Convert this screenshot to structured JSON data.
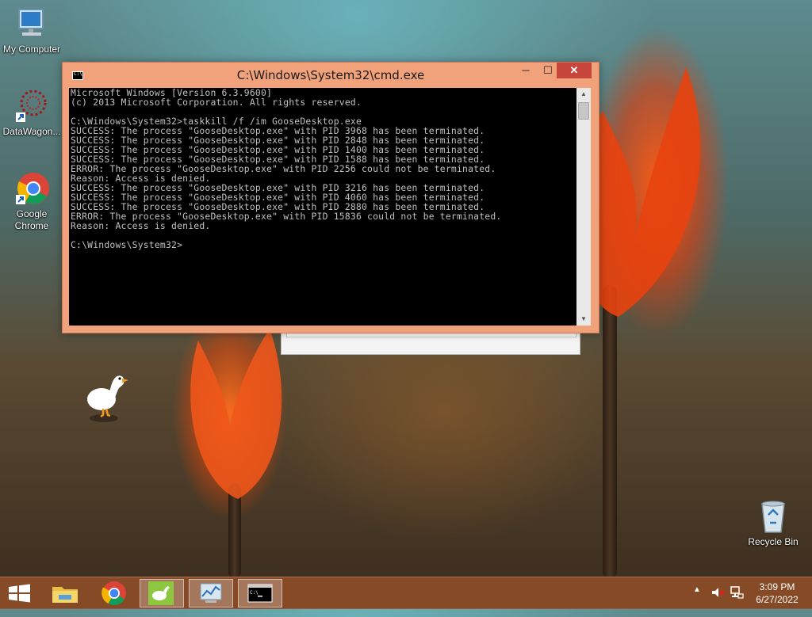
{
  "desktop": {
    "icons": [
      {
        "label": "My Computer"
      },
      {
        "label": "DataWagon..."
      },
      {
        "label": "Google Chrome"
      },
      {
        "label": "Recycle Bin"
      }
    ]
  },
  "cmd_window": {
    "title": "C:\\Windows\\System32\\cmd.exe",
    "controls": {
      "minimize": "─",
      "maximize": "☐",
      "close": "✕"
    },
    "lines": [
      "Microsoft Windows [Version 6.3.9600]",
      "(c) 2013 Microsoft Corporation. All rights reserved.",
      "",
      "C:\\Windows\\System32>taskkill /f /im GooseDesktop.exe",
      "SUCCESS: The process \"GooseDesktop.exe\" with PID 3968 has been terminated.",
      "SUCCESS: The process \"GooseDesktop.exe\" with PID 2848 has been terminated.",
      "SUCCESS: The process \"GooseDesktop.exe\" with PID 1400 has been terminated.",
      "SUCCESS: The process \"GooseDesktop.exe\" with PID 1588 has been terminated.",
      "ERROR: The process \"GooseDesktop.exe\" with PID 2256 could not be terminated.",
      "Reason: Access is denied.",
      "SUCCESS: The process \"GooseDesktop.exe\" with PID 3216 has been terminated.",
      "SUCCESS: The process \"GooseDesktop.exe\" with PID 4060 has been terminated.",
      "SUCCESS: The process \"GooseDesktop.exe\" with PID 2880 has been terminated.",
      "ERROR: The process \"GooseDesktop.exe\" with PID 15836 could not be terminated.",
      "Reason: Access is denied.",
      "",
      "C:\\Windows\\System32>"
    ],
    "colors": {
      "frame": "#f2a27b",
      "close": "#c7463b",
      "console_bg": "#000000",
      "console_text": "#c0c0c0"
    }
  },
  "taskbar": {
    "items": [
      {
        "name": "start-button",
        "icon": "windows-logo-icon"
      },
      {
        "name": "file-explorer",
        "icon": "folder-icon"
      },
      {
        "name": "google-chrome",
        "icon": "chrome-icon"
      },
      {
        "name": "desktop-goose",
        "icon": "goose-icon"
      },
      {
        "name": "performance-monitor",
        "icon": "monitor-chart-icon"
      },
      {
        "name": "command-prompt",
        "icon": "cmd-icon",
        "active": true
      }
    ],
    "tray": {
      "show_hidden": "▲",
      "volume": "muted",
      "network": "network-icon"
    },
    "clock": {
      "time": "3:09 PM",
      "date": "6/27/2022"
    }
  }
}
